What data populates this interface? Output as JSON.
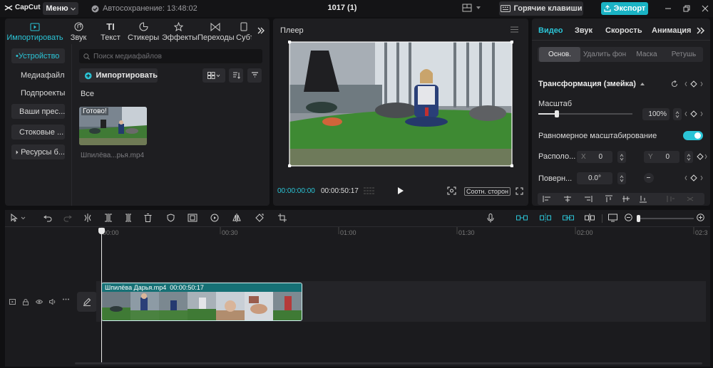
{
  "titlebar": {
    "app_name": "CapCut",
    "menu_label": "Меню",
    "autosave": "Автосохранение: 13:48:02",
    "project_title": "1017 (1)",
    "hotkeys_label": "Горячие клавиши",
    "export_label": "Экспорт"
  },
  "media_panel": {
    "tabs": [
      {
        "label": "Импортировать",
        "icon": "import-icon"
      },
      {
        "label": "Звук",
        "icon": "audio-icon"
      },
      {
        "label": "Текст",
        "icon": "text-icon"
      },
      {
        "label": "Стикеры",
        "icon": "sticker-icon"
      },
      {
        "label": "Эффекты",
        "icon": "effects-icon"
      },
      {
        "label": "Переходы",
        "icon": "transitions-icon"
      },
      {
        "label": "Субт",
        "icon": "subtitles-icon"
      }
    ],
    "sidebar": [
      "Устройство",
      "Медиафайлы",
      "Подпроекты",
      "Ваши прес...",
      "Стоковые ...",
      "Ресурсы б..."
    ],
    "search_placeholder": "Поиск медиафайлов",
    "import_button": "Импортировать",
    "filter_all": "Все",
    "thumb_status": "Готово!",
    "file_name": "Шпилёва...рья.mp4"
  },
  "player": {
    "title": "Плеер",
    "current_time": "00:00:00:00",
    "duration": "00:00:50:17",
    "ratio_label": "Соотн. сторон"
  },
  "properties": {
    "tabs": [
      "Видео",
      "Звук",
      "Скорость",
      "Анимация"
    ],
    "subtabs": [
      "Основ.",
      "Удалить фон",
      "Маска",
      "Ретушь"
    ],
    "section_title": "Трансформация (змейка)",
    "scale_label": "Масштаб",
    "scale_value": "100%",
    "scale_level": 0.2,
    "uniform_label": "Равномерное масштабирование",
    "uniform_on": true,
    "position_label": "Располо...",
    "x_label": "X",
    "x_value": "0",
    "y_label": "Y",
    "y_value": "0",
    "rotate_label": "Поверн...",
    "rotate_value": "0.0°"
  },
  "timeline": {
    "ruler": [
      "00:00",
      "00:30",
      "01:00",
      "01:30",
      "02:00",
      "02:3"
    ],
    "clip_name": "Шпилёва Дарья.mp4",
    "clip_duration": "00:00:50:17"
  },
  "colors": {
    "accent": "#2bc4d6",
    "export": "#1ab3c4",
    "clip": "#1e7c80"
  }
}
